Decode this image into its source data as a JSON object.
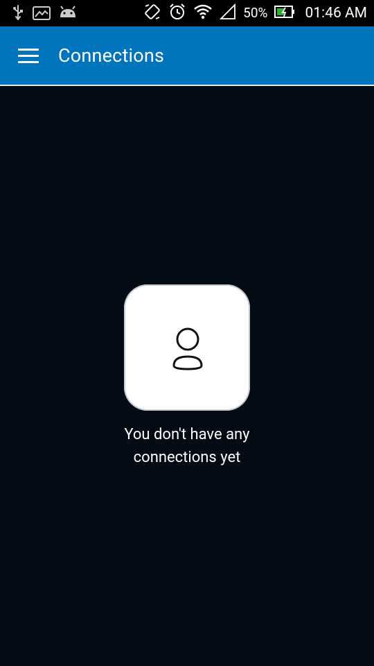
{
  "status_bar": {
    "battery_percent": "50%",
    "time": "01:46 AM",
    "left_icons": [
      "usb-icon",
      "image-icon",
      "android-icon"
    ],
    "right_icons": [
      "rotation-icon",
      "alarm-icon",
      "wifi-icon",
      "signal-icon",
      "battery-icon"
    ]
  },
  "app_bar": {
    "title": "Connections",
    "menu_icon": "menu-icon",
    "color": "#0074bd"
  },
  "empty_state": {
    "icon": "person-icon",
    "message_line1": "You don't have any",
    "message_line2": "connections yet"
  }
}
